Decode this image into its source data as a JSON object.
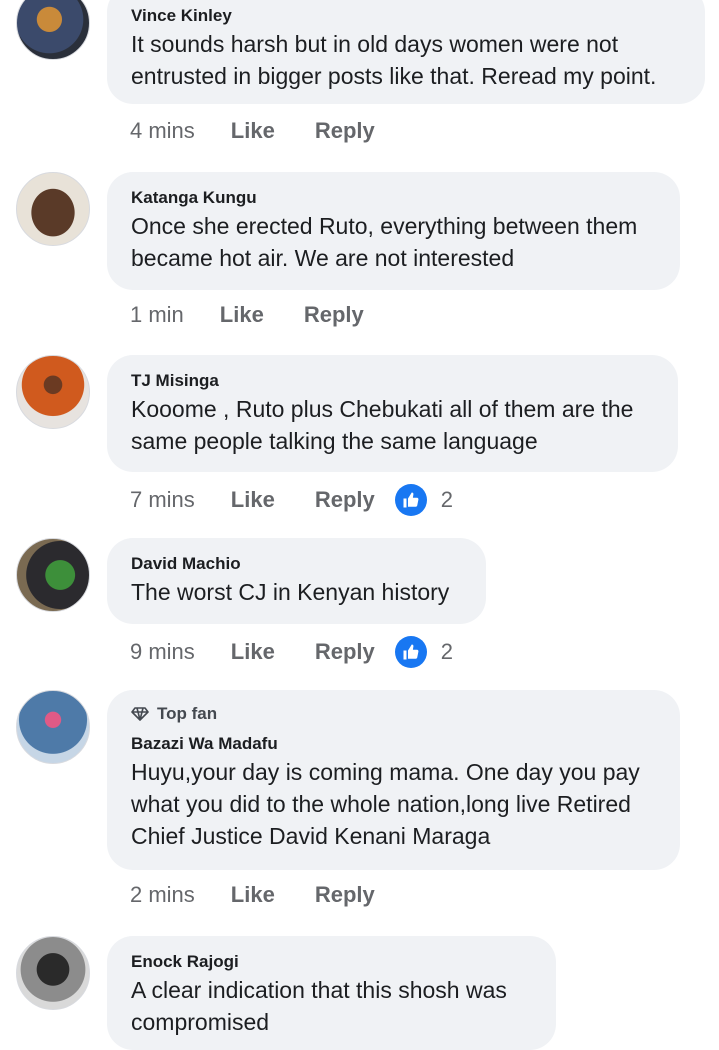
{
  "comments": [
    {
      "name": "Vince Kinley",
      "text": "It sounds harsh but in old days women were not entrusted in bigger posts like that. Reread my point.",
      "time": "4 mins",
      "like": "Like",
      "reply": "Reply"
    },
    {
      "name": "Katanga Kungu",
      "text": "Once she erected Ruto, everything between them became hot air. We are not interested",
      "time": "1 min",
      "like": "Like",
      "reply": "Reply"
    },
    {
      "name": "TJ Misinga",
      "text": "Kooome , Ruto plus Chebukati all of them are the same people talking the same language",
      "time": "7 mins",
      "like": "Like",
      "reply": "Reply",
      "reactions": "2"
    },
    {
      "name": "David Machio",
      "text": "The worst CJ in Kenyan history",
      "time": "9 mins",
      "like": "Like",
      "reply": "Reply",
      "reactions": "2"
    },
    {
      "badge": "Top fan",
      "name": "Bazazi Wa Madafu",
      "text": "Huyu,your day is coming mama. One day you pay what you did to the whole nation,long live Retired Chief Justice David Kenani  Maraga",
      "time": "2 mins",
      "like": "Like",
      "reply": "Reply"
    },
    {
      "name": "Enock Rajogi",
      "text": "A clear indication that this shosh was compromised"
    }
  ],
  "colors": {
    "bubble": "#f0f2f5",
    "meta_text": "#65676b",
    "like_badge": "#1877f2"
  }
}
